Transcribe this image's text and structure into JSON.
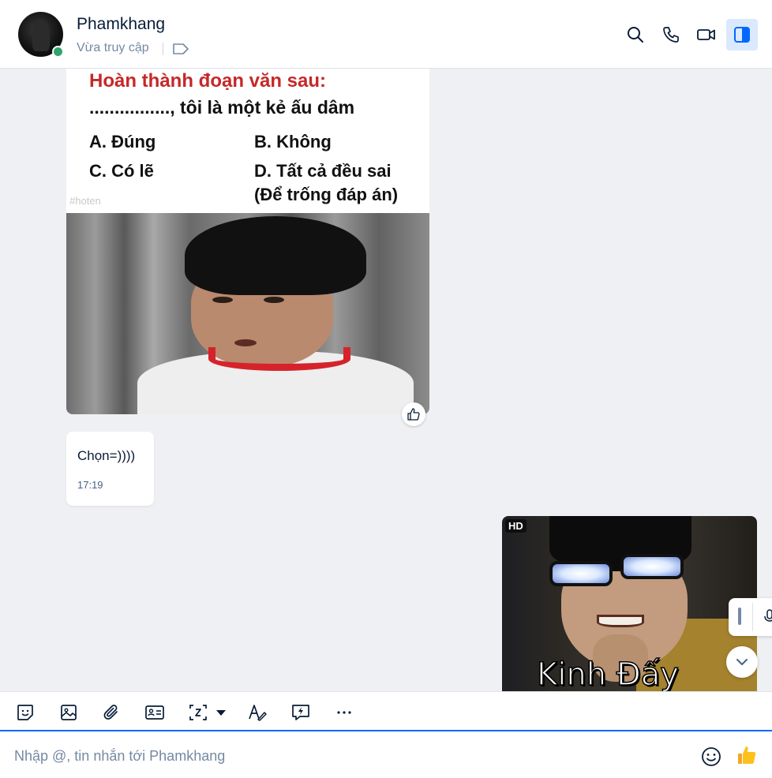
{
  "header": {
    "name": "Phamkhang",
    "status": "Vừa truy cập",
    "icons": [
      "tag-icon",
      "search-icon",
      "phone-icon",
      "video-call-icon",
      "sidebar-toggle-icon"
    ]
  },
  "messages": {
    "meme": {
      "title": "Hoàn thành đoạn văn sau:",
      "line": "................, tôi là một kẻ ấu dâm",
      "option_a": "A. Đúng",
      "option_b": "B. Không",
      "option_c": "C. Có lẽ",
      "option_d": "D. Tất cả đều sai",
      "option_d2": "(Để trống đáp án)",
      "watermark": "#hoten"
    },
    "text_message": {
      "text": "Chọn=))))",
      "time": "17:19"
    },
    "image_reply": {
      "badge": "HD",
      "caption": "Kinh Đấy"
    }
  },
  "toolbar": {
    "icons": [
      "sticker-icon",
      "image-icon",
      "attachment-icon",
      "contact-card-icon",
      "screenshot-icon",
      "format-text-icon",
      "quick-message-icon",
      "more-icon"
    ]
  },
  "composer": {
    "placeholder": "Nhập @, tin nhắn tới Phamkhang"
  },
  "colors": {
    "accent": "#0068ff",
    "online": "#30a46c",
    "chat_bg": "#eef0f3"
  }
}
